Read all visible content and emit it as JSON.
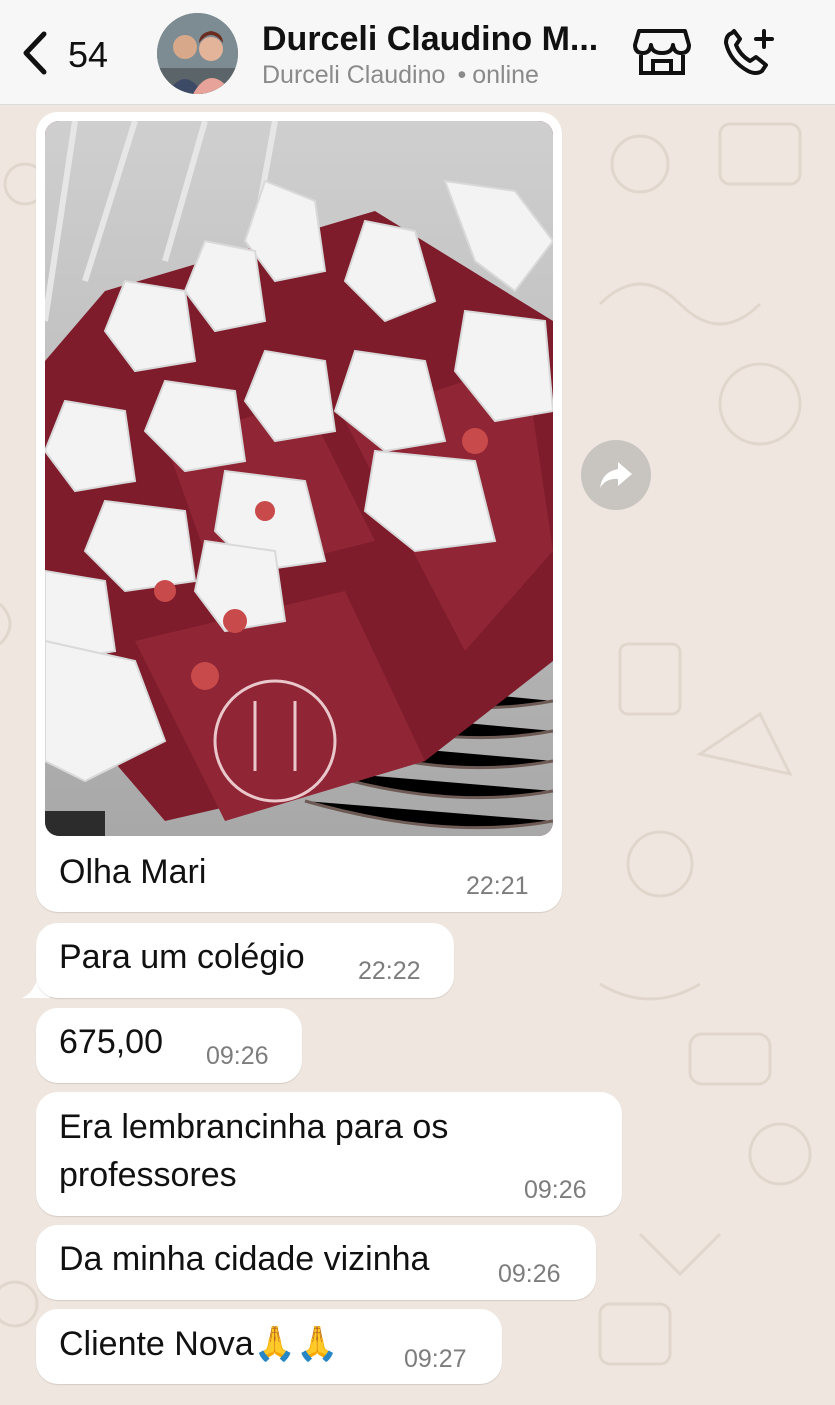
{
  "header": {
    "back_count": "54",
    "contact_name": "Durceli Claudino M...",
    "contact_sub": "Durceli Claudino",
    "status": "online"
  },
  "icons": {
    "back": "chevron-left-icon",
    "store": "store-icon",
    "call": "phone-plus-icon",
    "forward": "forward-icon"
  },
  "colors": {
    "background": "#efe7df",
    "bubble": "#ffffff",
    "photo_bag": "#8b2132"
  },
  "messages": [
    {
      "type": "image",
      "caption": "Olha Mari",
      "time": "22:21"
    },
    {
      "type": "text",
      "text": "Para um colégio",
      "time": "22:22"
    },
    {
      "type": "text",
      "text": "675,00",
      "time": "09:26"
    },
    {
      "type": "text",
      "lines": [
        "Era lembrancinha para os",
        "professores"
      ],
      "time": "09:26"
    },
    {
      "type": "text",
      "text": "Da minha cidade vizinha",
      "time": "09:26"
    },
    {
      "type": "text",
      "text": "Cliente Nova🙏🙏",
      "time": "09:27"
    }
  ]
}
